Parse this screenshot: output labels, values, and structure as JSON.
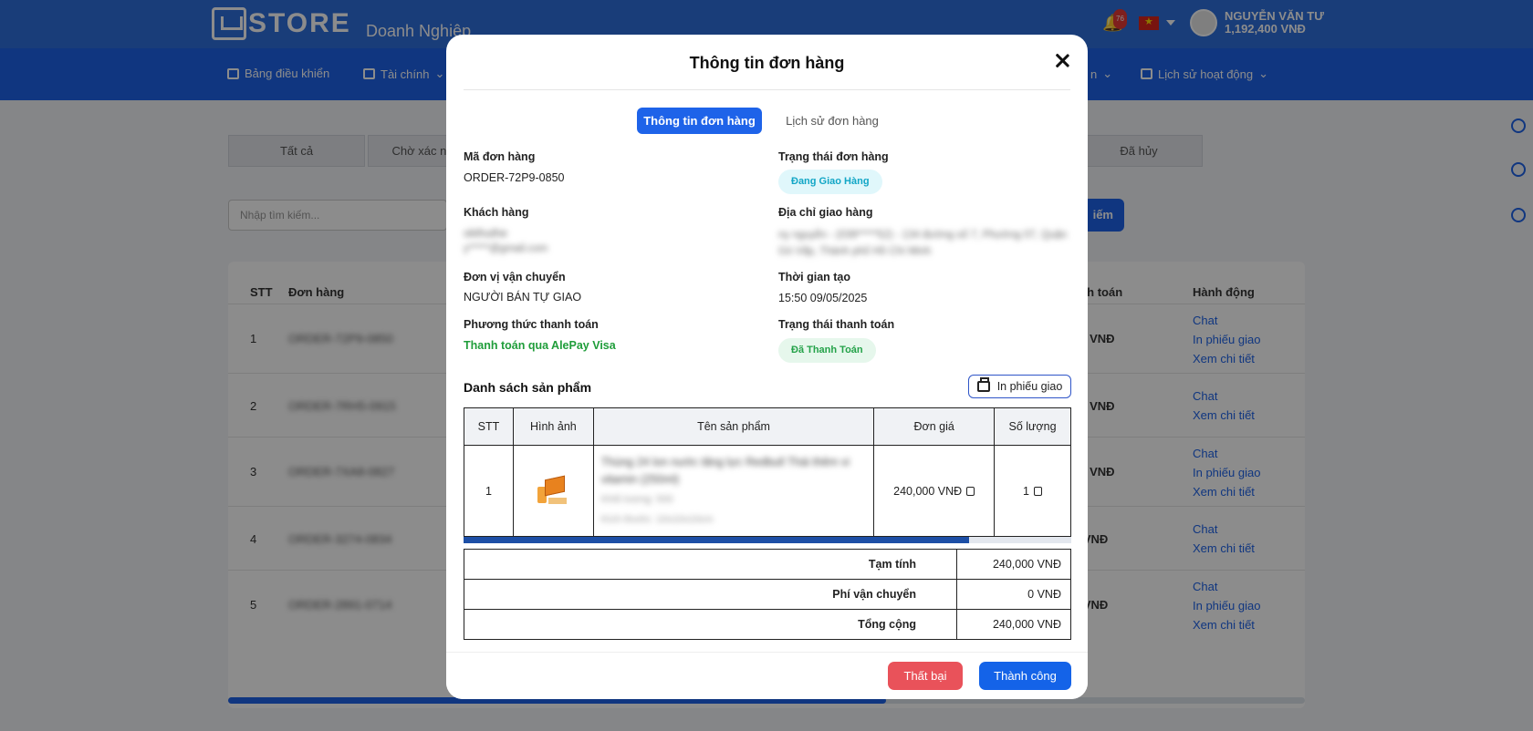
{
  "app": {
    "logo_text": "STORE",
    "subtitle": "Doanh Nghiệp",
    "notification_count": "76",
    "user_name": "NGUYỄN VĂN TƯ",
    "user_balance": "1,192,400 VNĐ"
  },
  "nav": {
    "items": [
      {
        "label": "Bảng điều khiển",
        "icon": "home-icon"
      },
      {
        "label": "Tài chính",
        "icon": "wallet-icon"
      },
      {
        "label": "Lịch sử hoạt động",
        "icon": "clipboard-icon"
      }
    ],
    "partial_label": "n"
  },
  "background": {
    "tabs": [
      "Tất cả",
      "Chờ xác nh",
      "Đã hủy"
    ],
    "search_placeholder": "Nhập tìm kiếm...",
    "search_button": "iếm",
    "columns": {
      "stt": "STT",
      "order": "Đơn hàng",
      "payment": "anh toán",
      "actions": "Hành động"
    },
    "rows": [
      {
        "num": "1",
        "order": "ORDER-72P9-0850",
        "amount": "00 VNĐ",
        "actions": [
          "Chat",
          "In phiếu giao",
          "Xem chi tiết"
        ]
      },
      {
        "num": "2",
        "order": "ORDER-7RH5-0915",
        "amount": "00 VNĐ",
        "actions": [
          "Chat",
          "Xem chi tiết"
        ]
      },
      {
        "num": "3",
        "order": "ORDER-7XA8-0827",
        "amount": "00 VNĐ",
        "actions": [
          "Chat",
          "In phiếu giao",
          "Xem chi tiết"
        ]
      },
      {
        "num": "4",
        "order": "ORDER-3274-0834",
        "amount": "0 VNĐ",
        "actions": [
          "Chat",
          "Xem chi tiết"
        ]
      },
      {
        "num": "5",
        "order": "ORDER-2891-0714",
        "amount": "0 VNĐ",
        "actions": [
          "Chat",
          "In phiếu giao",
          "Xem chi tiết"
        ]
      }
    ]
  },
  "modal": {
    "title": "Thông tin đơn hàng",
    "tabs": {
      "active": "Thông tin đơn hàng",
      "inactive": "Lịch sử đơn hàng"
    },
    "order_code_label": "Mã đơn hàng",
    "order_code": "ORDER-72P9-0850",
    "order_status_label": "Trạng thái đơn hàng",
    "order_status": "Đang Giao Hàng",
    "customer_label": "Khách hàng",
    "customer_name": "okthuthe",
    "customer_email": "y*****@gmail.com",
    "address_label": "Địa chỉ giao hàng",
    "address": "ny nguyễn - (039*****52) - 134 đường số 7, Phường 07, Quận Gò Vấp, Thành phố Hồ Chí Minh",
    "carrier_label": "Đơn vị vận chuyển",
    "carrier": "NGƯỜI BÁN TỰ GIAO",
    "created_label": "Thời gian tạo",
    "created": "15:50 09/05/2025",
    "pay_method_label": "Phương thức thanh toán",
    "pay_method": "Thanh toán qua AlePay Visa",
    "pay_status_label": "Trạng thái thanh toán",
    "pay_status": "Đã Thanh Toán",
    "products_title": "Danh sách sản phẩm",
    "print_button": "In phiếu giao",
    "table_headers": {
      "stt": "STT",
      "image": "Hình ảnh",
      "name": "Tên sản phẩm",
      "price": "Đơn giá",
      "qty": "Số lượng"
    },
    "product": {
      "stt": "1",
      "name": "Thùng 24 lon nước tăng lực Redbull Thái thêm vi vitamin (250ml)",
      "weight": "Khối lượng: 500",
      "size": "Kích thước: 10x10x10cm",
      "price": "240,000 VNĐ",
      "qty": "1"
    },
    "summary": {
      "subtotal_label": "Tạm tính",
      "subtotal": "240,000 VNĐ",
      "shipping_label": "Phí vận chuyển",
      "shipping": "0 VNĐ",
      "total_label": "Tổng cộng",
      "total": "240,000 VNĐ"
    },
    "fail_button": "Thất bại",
    "success_button": "Thành công"
  },
  "colors": {
    "primary": "#1e63e9",
    "danger": "#e9525a",
    "success_text": "#1f9d3a",
    "shipping_badge": "#12a6c6"
  }
}
